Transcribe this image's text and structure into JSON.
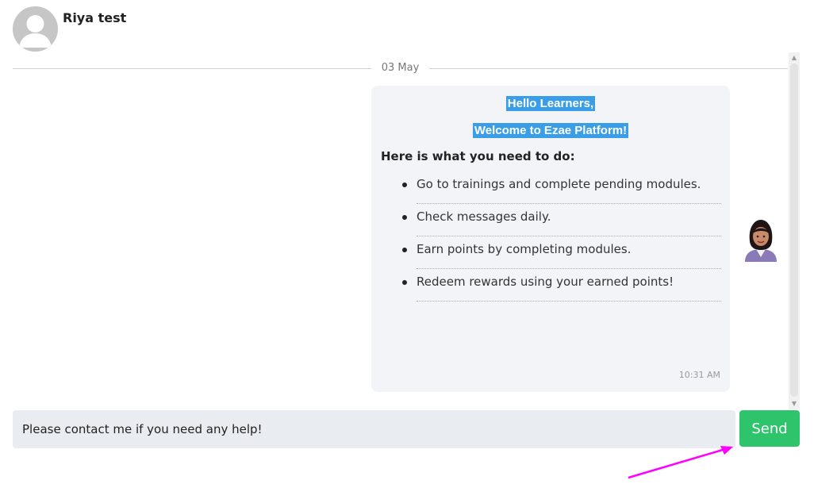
{
  "contact": {
    "name": "Riya test"
  },
  "conversation": {
    "date_label": "03 May",
    "message": {
      "greeting_line1": "Hello Learners,",
      "greeting_line2": "Welcome to Ezae Platform!",
      "instructions_heading": "Here is what you need to do:",
      "tasks": [
        "Go to trainings and complete pending modules.",
        "Check messages daily.",
        "Earn points by completing modules.",
        "Redeem rewards using your earned points!"
      ],
      "time": "10:31 AM"
    }
  },
  "composer": {
    "value": "Please contact me if you need any help!",
    "send_label": "Send"
  },
  "colors": {
    "highlight": "#3a9de8",
    "send_button": "#2ec46c",
    "annotation_arrow": "#ff00ff"
  }
}
